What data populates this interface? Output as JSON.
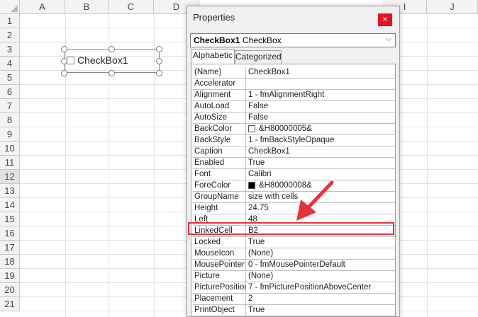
{
  "sheet": {
    "columns": [
      "A",
      "B",
      "C",
      "D",
      "I",
      "J"
    ],
    "rows": [
      "1",
      "2",
      "3",
      "4",
      "5",
      "6",
      "7",
      "8",
      "9",
      "10",
      "11",
      "12",
      "13",
      "14",
      "15",
      "16",
      "17",
      "18",
      "19",
      "20",
      "21"
    ],
    "selected_row": "12",
    "checkbox_label": "CheckBox1"
  },
  "properties": {
    "title": "Properties",
    "close": "×",
    "object_name": "CheckBox1",
    "object_type": "CheckBox",
    "dropdown_arrow": "⌵",
    "tabs": [
      "Alphabetic",
      "Categorized"
    ],
    "rows": [
      {
        "name": "(Name)",
        "value": "CheckBox1"
      },
      {
        "name": "Accelerator",
        "value": ""
      },
      {
        "name": "Alignment",
        "value": "1 - fmAlignmentRight"
      },
      {
        "name": "AutoLoad",
        "value": "False"
      },
      {
        "name": "AutoSize",
        "value": "False"
      },
      {
        "name": "BackColor",
        "value": "&H80000005&",
        "swatch": "#ffffff"
      },
      {
        "name": "BackStyle",
        "value": "1 - fmBackStyleOpaque"
      },
      {
        "name": "Caption",
        "value": "CheckBox1"
      },
      {
        "name": "Enabled",
        "value": "True"
      },
      {
        "name": "Font",
        "value": "Calibri"
      },
      {
        "name": "ForeColor",
        "value": "&H80000008&",
        "swatch": "#000000"
      },
      {
        "name": "GroupName",
        "value": "size with cells"
      },
      {
        "name": "Height",
        "value": "24.75"
      },
      {
        "name": "Left",
        "value": "48"
      },
      {
        "name": "LinkedCell",
        "value": "B2"
      },
      {
        "name": "Locked",
        "value": "True"
      },
      {
        "name": "MouseIcon",
        "value": "(None)"
      },
      {
        "name": "MousePointer",
        "value": "0 - fmMousePointerDefault"
      },
      {
        "name": "Picture",
        "value": "(None)"
      },
      {
        "name": "PicturePosition",
        "value": "7 - fmPicturePositionAboveCenter"
      },
      {
        "name": "Placement",
        "value": "2"
      },
      {
        "name": "PrintObject",
        "value": "True"
      }
    ]
  },
  "colors": {
    "highlight": "#e8323c",
    "close_bg": "#e81123",
    "excel_green": "#217346"
  }
}
